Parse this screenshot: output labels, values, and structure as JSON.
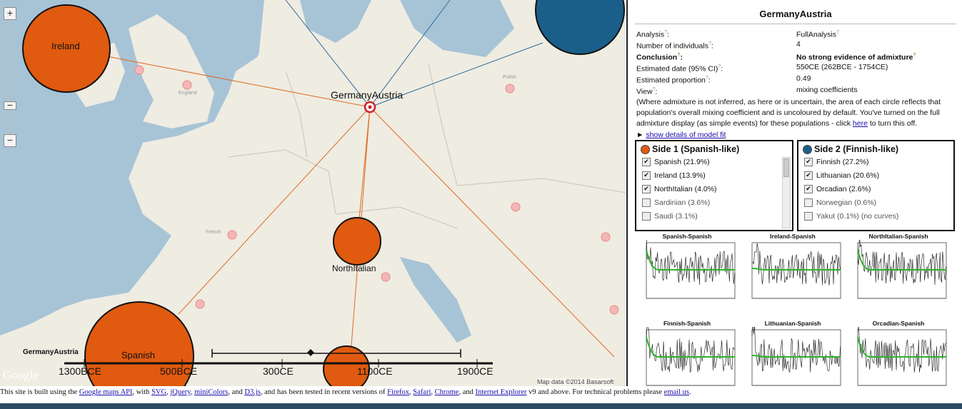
{
  "map": {
    "target_label": "GermanyAustria",
    "timeline_label": "GermanyAustria",
    "google_logo": "Google",
    "copyright": "Map data ©2014 Basarsoft",
    "circles": [
      {
        "label": "Ireland"
      },
      {
        "label": "NorthItalian"
      },
      {
        "label": "Spanish"
      }
    ],
    "timeline_ticks": [
      "1300BCE",
      "500BCE",
      "300CE",
      "1100CE",
      "1900CE"
    ],
    "place_labels": [
      "England",
      "French",
      "Polish"
    ],
    "zoom_in": "+",
    "zoom_out": "−",
    "zoom_mid": "−"
  },
  "panel": {
    "title": "GermanyAustria",
    "rows": [
      {
        "key": "Analysis",
        "value": "FullAnalysis",
        "bold": false
      },
      {
        "key": "Number of individuals",
        "value": "4",
        "bold": false
      },
      {
        "key": "Conclusion",
        "value": "No strong evidence of admixture",
        "bold": true
      },
      {
        "key": "Estimated date (95% CI)",
        "value": "550CE (262BCE - 1754CE)",
        "bold": false
      },
      {
        "key": "Estimated proportion",
        "value": "0.49",
        "bold": false
      },
      {
        "key": "View",
        "value": "mixing coefficients",
        "bold": false
      }
    ],
    "note_text": "(Where admixture is not inferred, as here or is uncertain, the area of each circle reflects that population's overall mixing coefficient and is uncoloured by default. You've turned on the full admixture display (as simple events) for these populations - click",
    "note_link": "here",
    "note_tail": "to turn this off.",
    "details_prefix": "►",
    "details_link": "show details of model fit",
    "side1": {
      "title": "Side 1 (Spanish-like)",
      "color": "#e05a10",
      "items": [
        {
          "label": "Spanish (21.9%)",
          "checked": true
        },
        {
          "label": "Ireland (13.9%)",
          "checked": true
        },
        {
          "label": "NorthItalian (4.0%)",
          "checked": true
        },
        {
          "label": "Sardinian (3.6%)",
          "checked": false
        },
        {
          "label": "Saudi (3.1%)",
          "checked": false
        }
      ]
    },
    "side2": {
      "title": "Side 2 (Finnish-like)",
      "color": "#1a5f8a",
      "items": [
        {
          "label": "Finnish (27.2%)",
          "checked": true
        },
        {
          "label": "Lithuanian (20.6%)",
          "checked": true
        },
        {
          "label": "Orcadian (2.6%)",
          "checked": true
        },
        {
          "label": "Norwegian (0.6%)",
          "checked": false
        },
        {
          "label": "Yakut (0.1%) (no curves)",
          "checked": false
        }
      ]
    },
    "plots": [
      {
        "title": "Spanish-Spanish"
      },
      {
        "title": "Ireland-Spanish"
      },
      {
        "title": "NorthItalian-Spanish"
      },
      {
        "title": "Finnish-Spanish"
      },
      {
        "title": "Lithuanian-Spanish"
      },
      {
        "title": "Orcadian-Spanish"
      }
    ]
  },
  "footer": {
    "t1": "This site is built using the",
    "l1": "Google maps API",
    "t2": ", with",
    "l2": "SVG",
    "t3": ",",
    "l3": "jQuery",
    "t4": ",",
    "l4": "miniColors",
    "t5": ", and",
    "l5": "D3.js",
    "t6": ", and has been tested in recent versions of",
    "l6": "Firefox",
    "t7": ",",
    "l7": "Safari",
    "t8": ",",
    "l8": "Chrome",
    "t9": ", and",
    "l9": "Internet Explorer",
    "t10": "v9 and above. For technical problems please",
    "l10": "email us",
    "t11": "."
  }
}
